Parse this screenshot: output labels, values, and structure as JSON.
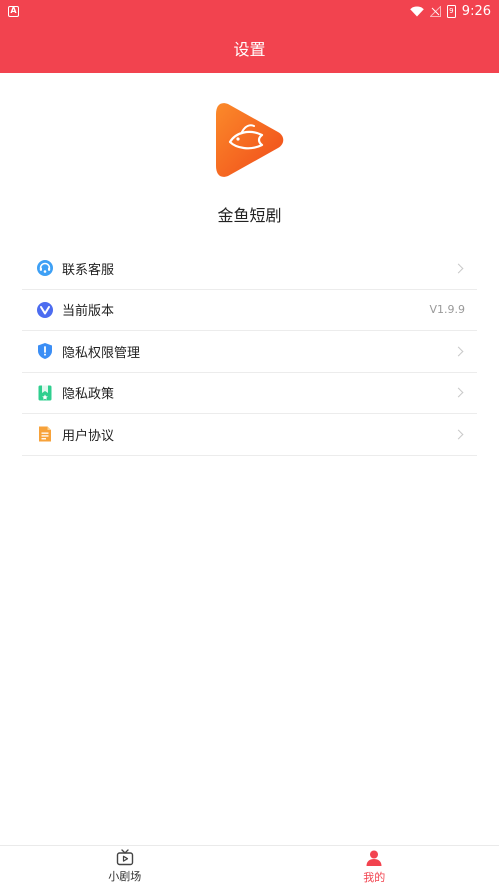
{
  "status_bar": {
    "time": "9:26",
    "battery_level": "9",
    "app_icon": "A"
  },
  "header": {
    "title": "设置"
  },
  "app": {
    "name": "金鱼短剧",
    "logo_icon": "goldfish-play-logo"
  },
  "menu": {
    "items": [
      {
        "label": "联系客服",
        "icon": "customer-service-icon",
        "value": ""
      },
      {
        "label": "当前版本",
        "icon": "version-icon",
        "value": "V1.9.9"
      },
      {
        "label": "隐私权限管理",
        "icon": "shield-icon",
        "value": ""
      },
      {
        "label": "隐私政策",
        "icon": "bookmark-icon",
        "value": ""
      },
      {
        "label": "用户协议",
        "icon": "document-icon",
        "value": ""
      }
    ]
  },
  "tabbar": {
    "tabs": [
      {
        "label": "小剧场",
        "icon": "tv-icon",
        "active": false
      },
      {
        "label": "我的",
        "icon": "user-icon",
        "active": true
      }
    ]
  },
  "colors": {
    "brand": "#f2434f",
    "logo_orange": "#f86a1c",
    "divider": "#ececec"
  }
}
